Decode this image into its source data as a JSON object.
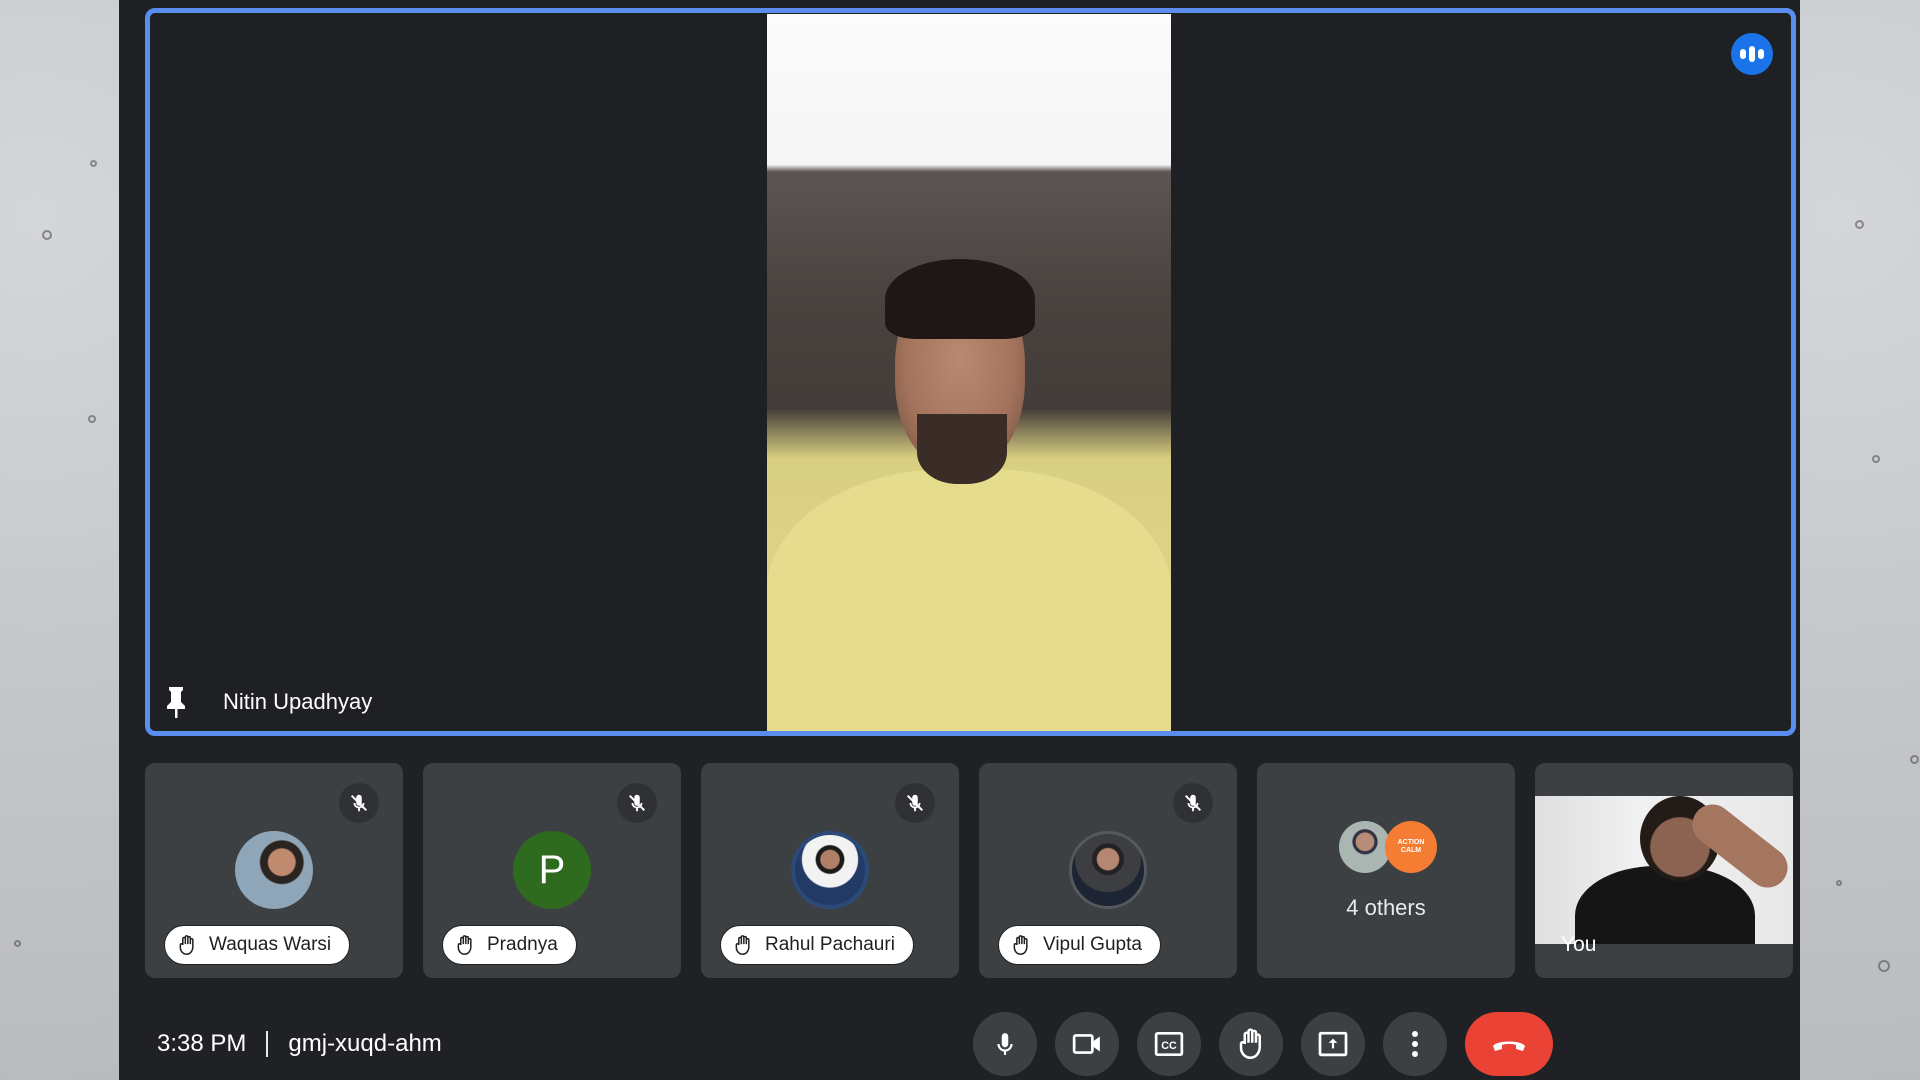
{
  "app": {
    "accent_color": "#5b8def",
    "end_call_color": "#ea4335"
  },
  "stage": {
    "speaker_name": "Nitin Upadhyay",
    "pinned": true,
    "speaking": true
  },
  "participants": [
    {
      "name": "Waquas Warsi",
      "muted": true,
      "hand_raised": true,
      "avatar": "photo"
    },
    {
      "name": "Pradnya",
      "muted": true,
      "hand_raised": true,
      "avatar_letter": "P",
      "avatar_color": "#2e6b1e"
    },
    {
      "name": "Rahul Pachauri",
      "muted": true,
      "hand_raised": true,
      "avatar": "photo"
    },
    {
      "name": "Vipul Gupta",
      "muted": true,
      "hand_raised": true,
      "avatar": "photo"
    }
  ],
  "others_tile": {
    "label": "4 others",
    "badge_line1": "ACTION",
    "badge_line2": "CALM"
  },
  "self_tile": {
    "label": "You"
  },
  "bottom_bar": {
    "time": "3:38 PM",
    "meeting_code": "gmj-xuqd-ahm",
    "controls": [
      {
        "name": "microphone",
        "icon": "mic-icon"
      },
      {
        "name": "camera",
        "icon": "videocam-icon"
      },
      {
        "name": "captions",
        "icon": "cc-icon",
        "text": "CC"
      },
      {
        "name": "raise-hand",
        "icon": "hand-icon"
      },
      {
        "name": "present",
        "icon": "present-screen-icon"
      },
      {
        "name": "more-options",
        "icon": "more-vert-icon"
      },
      {
        "name": "leave-call",
        "icon": "call-end-icon"
      }
    ]
  }
}
